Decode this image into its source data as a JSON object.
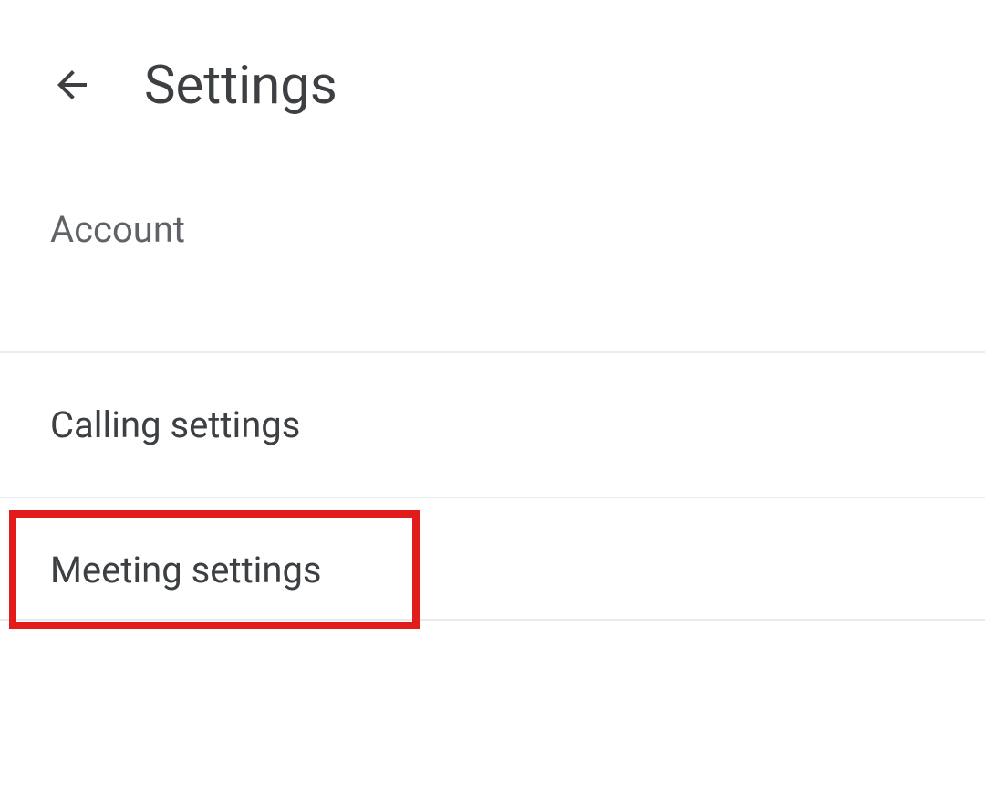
{
  "header": {
    "title": "Settings"
  },
  "sections": {
    "account_label": "Account"
  },
  "menu": {
    "calling": "Calling settings",
    "meeting": "Meeting settings"
  }
}
